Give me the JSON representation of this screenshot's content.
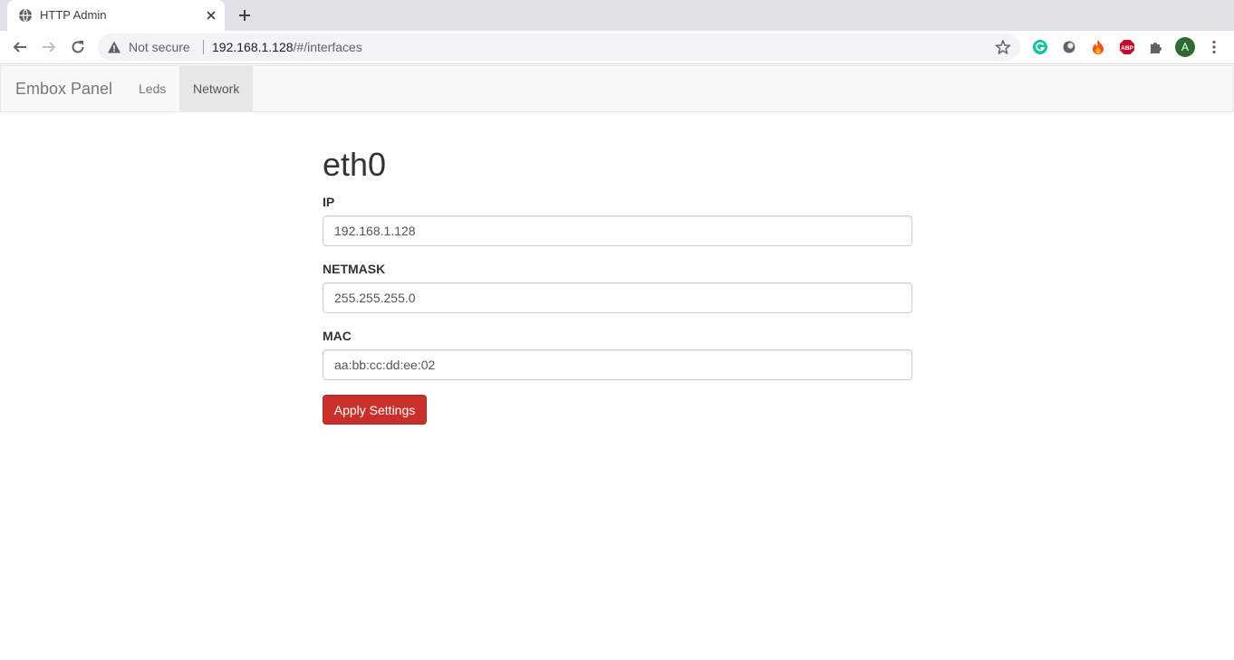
{
  "browser": {
    "tab": {
      "title": "HTTP Admin",
      "favicon": "globe-icon"
    },
    "omnibox": {
      "security_label": "Not secure",
      "url_host": "192.168.1.128",
      "url_path": "/#/interfaces"
    },
    "extensions": [
      {
        "name": "grammarly-icon",
        "color": "#15c39a"
      },
      {
        "name": "extension-circle-icon",
        "color": "#5f6368"
      },
      {
        "name": "fire-extension-icon",
        "color": "#f4511e"
      },
      {
        "name": "adblock-plus-icon",
        "color": "#c70d2c",
        "label": "ABP"
      },
      {
        "name": "puzzle-icon",
        "color": "#5f6368"
      },
      {
        "name": "profile-avatar",
        "color": "#2e6b30",
        "label": "A"
      },
      {
        "name": "menu-dots-icon",
        "color": "#5f6368"
      }
    ]
  },
  "navbar": {
    "brand": "Embox Panel",
    "links": [
      {
        "label": "Leds",
        "active": false
      },
      {
        "label": "Network",
        "active": true
      }
    ]
  },
  "interface": {
    "name": "eth0",
    "fields": {
      "ip": {
        "label": "IP",
        "value": "192.168.1.128"
      },
      "netmask": {
        "label": "NETMASK",
        "value": "255.255.255.0"
      },
      "mac": {
        "label": "MAC",
        "value": "aa:bb:cc:dd:ee:02"
      }
    },
    "apply_label": "Apply Settings"
  },
  "colors": {
    "danger_button": "#c9302c",
    "navbar_bg": "#f8f8f8",
    "navbar_active": "#e7e7e7"
  }
}
